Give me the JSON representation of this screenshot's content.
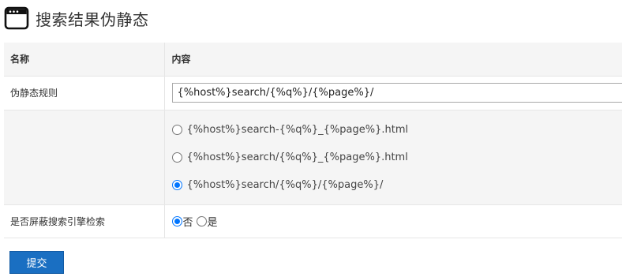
{
  "header": {
    "title": "搜索结果伪静态",
    "icon": "browser-window-icon"
  },
  "table": {
    "col_name_header": "名称",
    "col_content_header": "内容",
    "rule_label": "伪静态规则",
    "rule_value": "{%host%}search/{%q%}/{%page%}/",
    "options": [
      {
        "label": "{%host%}search-{%q%}_{%page%}.html",
        "checked": false
      },
      {
        "label": "{%host%}search/{%q%}_{%page%}.html",
        "checked": false
      },
      {
        "label": "{%host%}search/{%q%}/{%page%}/",
        "checked": true
      }
    ],
    "block_label": "是否屏蔽搜索引擎检索",
    "block_no": "否",
    "block_yes": "是",
    "block_selected": "否"
  },
  "submit_label": "提交",
  "colors": {
    "accent": "#1a6fc2",
    "radio_checked": "#0075ff",
    "row_shade": "#f5f5f5"
  }
}
